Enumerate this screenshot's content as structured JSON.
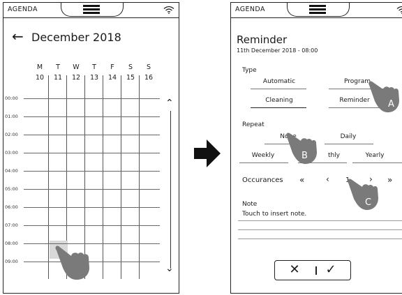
{
  "left_screen": {
    "app_title": "AGENDA",
    "month_label": "December 2018",
    "days": [
      {
        "letter": "M",
        "num": "10"
      },
      {
        "letter": "T",
        "num": "11"
      },
      {
        "letter": "W",
        "num": "12"
      },
      {
        "letter": "T",
        "num": "13"
      },
      {
        "letter": "F",
        "num": "14"
      },
      {
        "letter": "S",
        "num": "15"
      },
      {
        "letter": "S",
        "num": "16"
      }
    ],
    "hours": [
      "00:00",
      "01:00",
      "02:00",
      "03:00",
      "04:00",
      "05:00",
      "06:00",
      "07:00",
      "08:00",
      "09:00"
    ],
    "selected_slot": {
      "day": "10",
      "hour": "08:00"
    }
  },
  "right_screen": {
    "app_title": "AGENDA",
    "title": "Reminder",
    "subtitle": "11th December 2018 - 08:00",
    "type": {
      "label": "Type",
      "options": [
        "Automatic",
        "Program",
        "Cleaning",
        "Reminder"
      ]
    },
    "repeat": {
      "label": "Repeat",
      "options": [
        "None",
        "Daily",
        "Weekly",
        "Monthly",
        "Yearly"
      ],
      "monthly_visible": "thly"
    },
    "occurrences": {
      "label": "Occurances",
      "first": "«",
      "prev": "‹",
      "value": "1",
      "next": "›",
      "last": "»"
    },
    "note": {
      "label": "Note",
      "placeholder": "Touch to insert note."
    },
    "cancel_glyph": "✕",
    "confirm_glyph": "✓",
    "callouts": [
      "A",
      "B",
      "C"
    ]
  },
  "colors": {
    "hand_gray": "#7a7a7a",
    "selection_gray": "#d9d9d9",
    "line": "#222222"
  }
}
